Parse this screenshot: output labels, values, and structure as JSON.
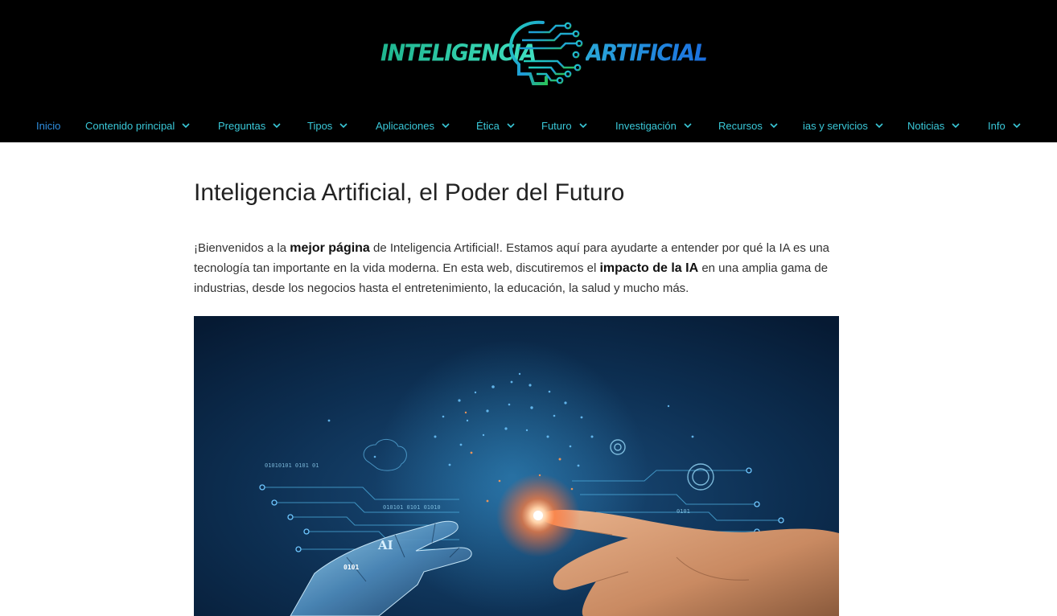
{
  "logo": {
    "left_text": "INTELIGENCIA",
    "right_text": "ARTIFICIAL",
    "icon": "circuit-head-icon"
  },
  "nav": {
    "items": [
      {
        "label": "Inicio",
        "active": true,
        "dropdown": false
      },
      {
        "label": "Contenido principal",
        "dropdown": true
      },
      {
        "label": "Preguntas",
        "dropdown": true
      },
      {
        "label": "Tipos",
        "dropdown": true
      },
      {
        "label": "Aplicaciones",
        "dropdown": true
      },
      {
        "label": "Ética",
        "dropdown": true
      },
      {
        "label": "Futuro",
        "dropdown": true
      },
      {
        "label": "Investigación",
        "dropdown": true
      },
      {
        "label": "Recursos",
        "dropdown": true
      },
      {
        "label": "ias y servicios",
        "dropdown": true
      },
      {
        "label": "Noticias",
        "dropdown": true
      },
      {
        "label": "Info",
        "dropdown": true
      }
    ]
  },
  "main": {
    "title": "Inteligencia Artificial, el Poder del Futuro",
    "intro": {
      "p1": "¡Bienvenidos a la ",
      "b1": "mejor página",
      "p2": " de Inteligencia Artificial!. Estamos aquí para ayudarte a entender por qué la IA es una tecnología tan importante en la vida moderna. En esta web, discutiremos el ",
      "b2": "impacto de la IA",
      "p3": " en una amplia gama de industrias, desde los negocios hasta el entretenimiento, la educación, la salud y mucho más."
    },
    "hero": {
      "ai_label": "AI",
      "binary_label": "0101"
    }
  },
  "colors": {
    "header_bg": "#000000",
    "nav_text": "#3ac8d8",
    "nav_active": "#2f8fe0",
    "logo_green": "#2bd6b0",
    "logo_blue": "#1b6fe0"
  }
}
